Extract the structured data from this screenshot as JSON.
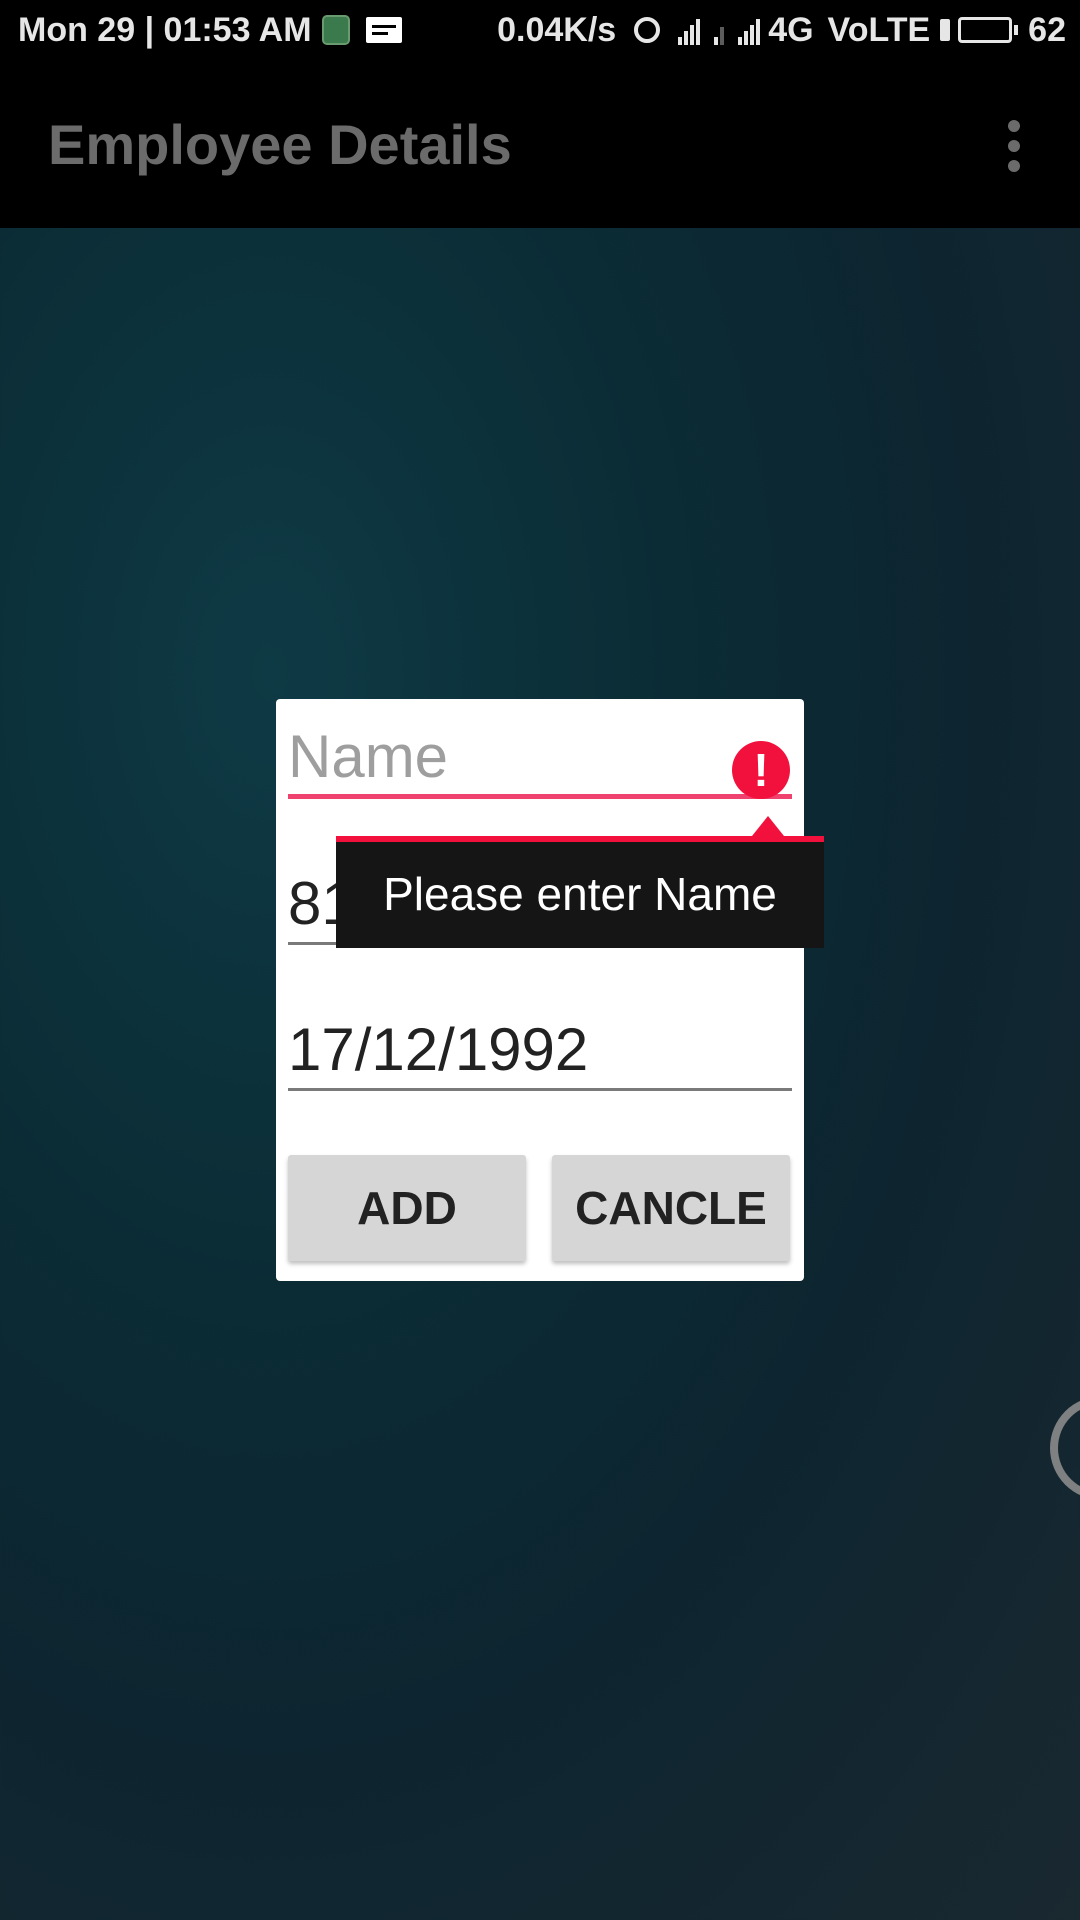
{
  "status_bar": {
    "datetime": "Mon 29 | 01:53 AM",
    "net_speed": "0.04K/s",
    "network": "4G",
    "volte": "VoLTE",
    "battery_percent": "62",
    "battery_level": 0.62,
    "battery_fill_color": "#3fd23f",
    "icons": [
      "app-notification-icon",
      "message-icon",
      "alarm-icon",
      "signal-icon",
      "signal-weak-icon",
      "signal-icon",
      "charging-icon",
      "battery-icon"
    ]
  },
  "app_bar": {
    "title": "Employee Details",
    "menu_icon": "overflow-menu-icon"
  },
  "dialog": {
    "name_placeholder": "Name",
    "name_value": "",
    "phone_value": "8197926575",
    "date_value": "17/12/1992",
    "error_icon": "error-icon",
    "error_glyph": "!",
    "error_message": "Please enter Name",
    "add_label": "ADD",
    "cancel_label": "CANCLE"
  },
  "colors": {
    "error": "#f2113c",
    "focus_underline": "#f0426e",
    "button_bg": "#d6d6d6"
  }
}
